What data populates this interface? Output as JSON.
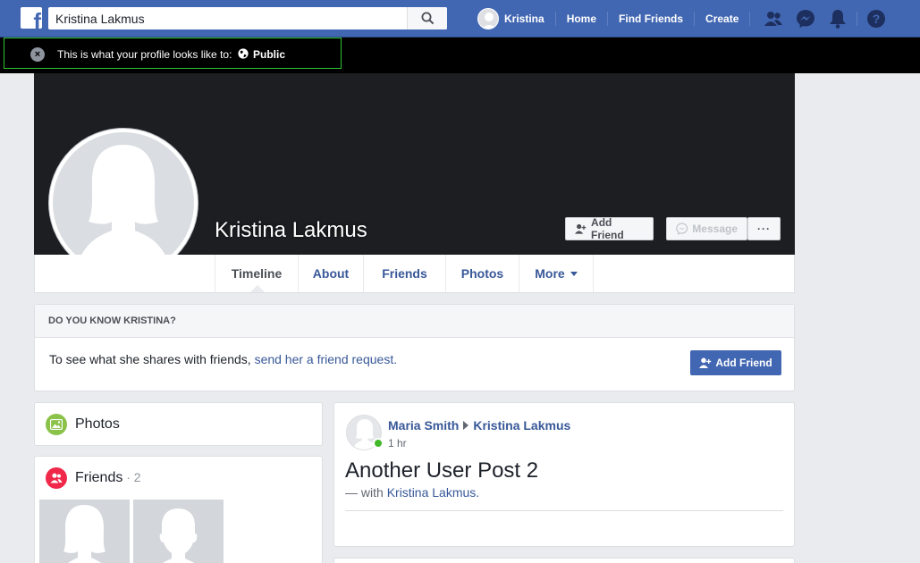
{
  "search": {
    "value": "Kristina Lakmus"
  },
  "topnav": {
    "user_name": "Kristina",
    "home": "Home",
    "find_friends": "Find Friends",
    "create": "Create",
    "icons": [
      "friend-requests-icon",
      "messenger-icon",
      "notifications-bell-icon",
      "help-icon"
    ]
  },
  "notice": {
    "text": "This is what your profile looks like to:",
    "audience": "Public"
  },
  "profile": {
    "name": "Kristina Lakmus",
    "add_friend": "Add Friend",
    "message": "Message",
    "more_dots": "···"
  },
  "tabs": [
    {
      "label": "Timeline"
    },
    {
      "label": "About"
    },
    {
      "label": "Friends"
    },
    {
      "label": "Photos"
    },
    {
      "label": "More"
    }
  ],
  "know": {
    "heading": "DO YOU KNOW KRISTINA?",
    "text": "To see what she shares with friends, ",
    "link": "send her a friend request.",
    "button": "Add Friend"
  },
  "sidebar": {
    "photos_title": "Photos",
    "friends_title": "Friends",
    "friends_count": " · 2"
  },
  "post": {
    "author": "Maria Smith",
    "target": "Kristina Lakmus",
    "time": "1 hr",
    "body": "Another User Post 2",
    "with_prefix": "— with ",
    "with_name": "Kristina Lakmus."
  },
  "colors": {
    "brand": "#4267b2",
    "link": "#385898",
    "online": "#42b72a",
    "notice_outline": "#31c331"
  }
}
